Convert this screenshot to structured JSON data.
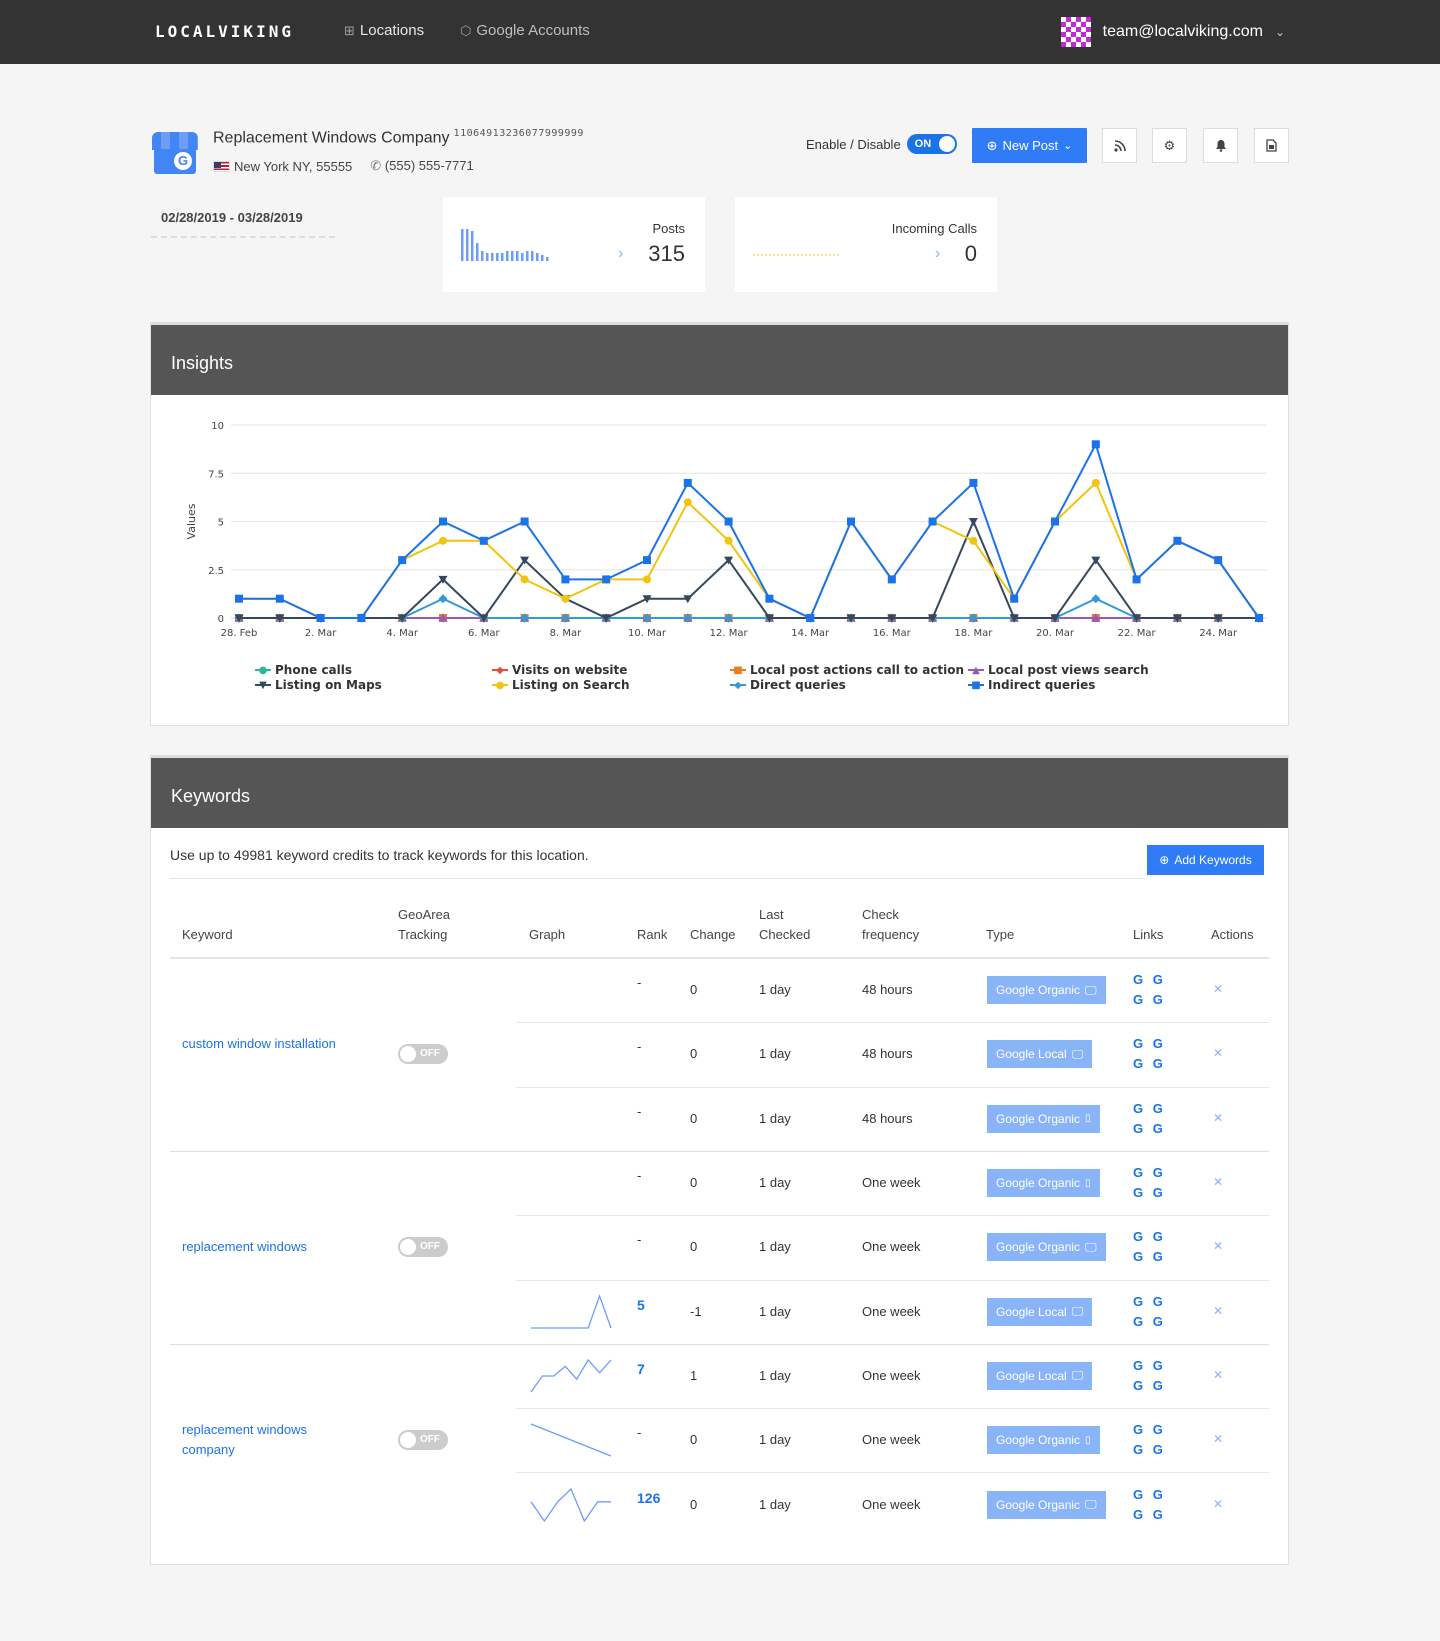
{
  "nav": {
    "brand": "LOCALVIKING",
    "items": [
      {
        "label": "Locations",
        "icon": "sitemap-icon"
      },
      {
        "label": "Google Accounts",
        "icon": "cube-icon"
      }
    ],
    "user_email": "team@localviking.com"
  },
  "location": {
    "name": "Replacement Windows Company",
    "id": "11064913236077999999",
    "address": "New York NY, 55555",
    "phone": "(555) 555-7771",
    "toggle_label": "Enable / Disable",
    "toggle_state": "ON",
    "new_post_label": "New Post"
  },
  "date_range": "02/28/2019 - 03/28/2019",
  "stats": {
    "posts": {
      "label": "Posts",
      "value": "315"
    },
    "calls": {
      "label": "Incoming Calls",
      "value": "0"
    }
  },
  "insights": {
    "title": "Insights",
    "legend": [
      {
        "name": "Phone calls",
        "color": "#26b99a",
        "marker": "●"
      },
      {
        "name": "Visits on website",
        "color": "#e74c3c",
        "marker": "◆"
      },
      {
        "name": "Local post actions call to action",
        "color": "#e67e22",
        "marker": "■"
      },
      {
        "name": "Local post views search",
        "color": "#9b59b6",
        "marker": "▲"
      },
      {
        "name": "Listing on Maps",
        "color": "#34495e",
        "marker": "▼"
      },
      {
        "name": "Listing on Search",
        "color": "#f1c40f",
        "marker": "●"
      },
      {
        "name": "Direct queries",
        "color": "#3498db",
        "marker": "◆"
      },
      {
        "name": "Indirect queries",
        "color": "#1a73e8",
        "marker": "■"
      }
    ]
  },
  "chart_data": {
    "type": "line",
    "ylabel": "Values",
    "ylim": [
      0,
      10
    ],
    "yticks": [
      0,
      2.5,
      5,
      7.5,
      10
    ],
    "x": [
      "28. Feb",
      "1. Mar",
      "2. Mar",
      "3. Mar",
      "4. Mar",
      "5. Mar",
      "6. Mar",
      "7. Mar",
      "8. Mar",
      "9. Mar",
      "10. Mar",
      "11. Mar",
      "12. Mar",
      "13. Mar",
      "14. Mar",
      "15. Mar",
      "16. Mar",
      "17. Mar",
      "18. Mar",
      "19. Mar",
      "20. Mar",
      "21. Mar",
      "22. Mar",
      "23. Mar",
      "24. Mar",
      "25. Mar"
    ],
    "xtick_labels": [
      "28. Feb",
      "2. Mar",
      "4. Mar",
      "6. Mar",
      "8. Mar",
      "10. Mar",
      "12. Mar",
      "14. Mar",
      "16. Mar",
      "18. Mar",
      "20. Mar",
      "22. Mar",
      "24. Mar"
    ],
    "grid": true,
    "legend_position": "bottom",
    "series": [
      {
        "name": "Phone calls",
        "color": "#26b99a",
        "values": [
          0,
          0,
          0,
          0,
          0,
          0,
          0,
          0,
          0,
          0,
          0,
          0,
          0,
          0,
          0,
          0,
          0,
          0,
          0,
          0,
          0,
          0,
          0,
          0,
          0,
          0
        ]
      },
      {
        "name": "Visits on website",
        "color": "#e74c3c",
        "values": [
          0,
          0,
          0,
          0,
          0,
          0,
          0,
          0,
          0,
          0,
          0,
          0,
          0,
          0,
          0,
          0,
          0,
          0,
          0,
          0,
          0,
          0,
          0,
          0,
          0,
          0
        ]
      },
      {
        "name": "Local post actions call to action",
        "color": "#e67e22",
        "values": [
          0,
          0,
          0,
          0,
          0,
          0,
          0,
          0,
          0,
          0,
          0,
          0,
          0,
          0,
          0,
          0,
          0,
          0,
          0,
          0,
          0,
          0,
          0,
          0,
          0,
          0
        ]
      },
      {
        "name": "Local post views search",
        "color": "#9b59b6",
        "values": [
          0,
          0,
          0,
          0,
          0,
          0,
          0,
          0,
          0,
          0,
          0,
          0,
          0,
          0,
          0,
          0,
          0,
          0,
          0,
          0,
          0,
          0,
          0,
          0,
          0,
          0
        ]
      },
      {
        "name": "Direct queries",
        "color": "#3498db",
        "values": [
          0,
          0,
          0,
          0,
          0,
          1,
          0,
          0,
          0,
          0,
          0,
          0,
          0,
          0,
          0,
          0,
          0,
          0,
          0,
          0,
          0,
          1,
          0,
          0,
          0,
          0
        ]
      },
      {
        "name": "Listing on Maps",
        "color": "#34495e",
        "values": [
          0,
          0,
          0,
          0,
          0,
          2,
          0,
          3,
          1,
          0,
          1,
          1,
          3,
          0,
          0,
          0,
          0,
          0,
          5,
          0,
          0,
          3,
          0,
          0,
          0,
          0
        ]
      },
      {
        "name": "Listing on Search",
        "color": "#f1c40f",
        "values": [
          1,
          1,
          0,
          0,
          3,
          4,
          4,
          2,
          1,
          2,
          2,
          6,
          4,
          1,
          0,
          5,
          2,
          5,
          4,
          1,
          5,
          7,
          2,
          4,
          3,
          0
        ]
      },
      {
        "name": "Indirect queries",
        "color": "#1a73e8",
        "values": [
          1,
          1,
          0,
          0,
          3,
          5,
          4,
          5,
          2,
          2,
          3,
          7,
          5,
          1,
          0,
          5,
          2,
          5,
          7,
          1,
          5,
          9,
          2,
          4,
          3,
          0
        ]
      }
    ]
  },
  "keywords": {
    "title": "Keywords",
    "intro": "Use up to 49981 keyword credits to track keywords for this location.",
    "add_label": "Add Keywords",
    "headers": {
      "keyword": "Keyword",
      "geo": [
        "GeoArea",
        "Tracking"
      ],
      "graph": "Graph",
      "rank": "Rank",
      "change": "Change",
      "last": [
        "Last",
        "Checked"
      ],
      "freq": [
        "Check",
        "frequency"
      ],
      "type": "Type",
      "links": "Links",
      "actions": "Actions"
    },
    "groups": [
      {
        "name": "custom window installation",
        "geo": "OFF",
        "rows": [
          {
            "rank": "-",
            "change": "0",
            "last": "1 day",
            "freq": "48 hours",
            "type": "Google Organic",
            "device": "desktop",
            "links": "G G G G",
            "spark": []
          },
          {
            "rank": "-",
            "change": "0",
            "last": "1 day",
            "freq": "48 hours",
            "type": "Google Local",
            "device": "desktop",
            "links": "G G G G",
            "spark": []
          },
          {
            "rank": "-",
            "change": "0",
            "last": "1 day",
            "freq": "48 hours",
            "type": "Google Organic",
            "device": "mobile",
            "links": "G G G G",
            "spark": []
          }
        ]
      },
      {
        "name": "replacement windows",
        "geo": "OFF",
        "rows": [
          {
            "rank": "-",
            "change": "0",
            "last": "1 day",
            "freq": "One week",
            "type": "Google Organic",
            "device": "mobile",
            "links": "G G G G",
            "spark": []
          },
          {
            "rank": "-",
            "change": "0",
            "last": "1 day",
            "freq": "One week",
            "type": "Google Organic",
            "device": "desktop",
            "links": "G G G G",
            "spark": []
          },
          {
            "rank": "5",
            "change": "-1",
            "last": "1 day",
            "freq": "One week",
            "type": "Google Local",
            "device": "desktop",
            "links": "G G G G",
            "spark": [
              0,
              0,
              0,
              0,
              0,
              0,
              1,
              0
            ]
          }
        ]
      },
      {
        "name": "replacement windows company",
        "geo": "OFF",
        "rows": [
          {
            "rank": "7",
            "change": "1",
            "last": "1 day",
            "freq": "One week",
            "type": "Google Local",
            "device": "desktop",
            "links": "G G G G",
            "spark": [
              0,
              0.5,
              0.5,
              0.8,
              0.4,
              1,
              0.6,
              1
            ]
          },
          {
            "rank": "-",
            "change": "0",
            "last": "1 day",
            "freq": "One week",
            "type": "Google Organic",
            "device": "mobile",
            "links": "G G G G",
            "spark": [
              1,
              0
            ]
          },
          {
            "rank": "126",
            "change": "0",
            "last": "1 day",
            "freq": "One week",
            "type": "Google Organic",
            "device": "desktop",
            "links": "G G G G",
            "spark": [
              0.6,
              0,
              0.6,
              1,
              0,
              0.6,
              0.6
            ]
          }
        ]
      }
    ]
  }
}
